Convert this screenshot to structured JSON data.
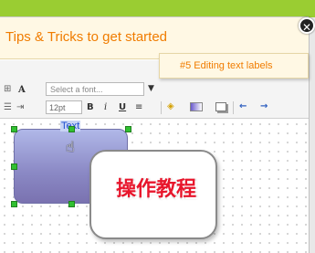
{
  "tips": {
    "title": "Tips & Tricks to get started",
    "close_symbol": "✕",
    "dropdown_item": "#5 Editing text labels"
  },
  "toolbar": {
    "font_placeholder": "Select a font...",
    "font_size": "12pt",
    "bold": "B",
    "italic": "i",
    "underline": "U",
    "align": "≡",
    "text_icon": "A",
    "back": "←",
    "forward": "→"
  },
  "canvas": {
    "shape_label": "Text"
  },
  "callout": {
    "text": "操作教程"
  },
  "colors": {
    "background": "#9acd32",
    "tips_accent": "#f07c00",
    "callout_text": "#e8162c",
    "handle": "#30c030"
  }
}
